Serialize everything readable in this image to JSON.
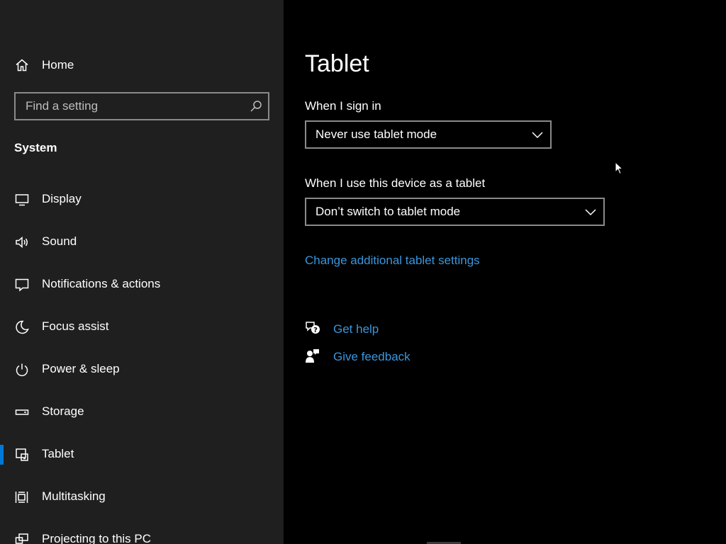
{
  "sidebar": {
    "home_label": "Home",
    "search": {
      "placeholder": "Find a setting",
      "value": ""
    },
    "section_title": "System",
    "items": [
      {
        "label": "Display",
        "icon": "monitor-icon",
        "selected": false
      },
      {
        "label": "Sound",
        "icon": "speaker-icon",
        "selected": false
      },
      {
        "label": "Notifications & actions",
        "icon": "notification-icon",
        "selected": false
      },
      {
        "label": "Focus assist",
        "icon": "moon-icon",
        "selected": false
      },
      {
        "label": "Power & sleep",
        "icon": "power-icon",
        "selected": false
      },
      {
        "label": "Storage",
        "icon": "storage-icon",
        "selected": false
      },
      {
        "label": "Tablet",
        "icon": "tablet-icon",
        "selected": true
      },
      {
        "label": "Multitasking",
        "icon": "multitasking-icon",
        "selected": false
      },
      {
        "label": "Projecting to this PC",
        "icon": "projecting-icon",
        "selected": false
      }
    ]
  },
  "main": {
    "title": "Tablet",
    "sign_in": {
      "label": "When I sign in",
      "selected": "Never use tablet mode"
    },
    "tablet_use": {
      "label": "When I use this device as a tablet",
      "selected": "Don’t switch to tablet mode"
    },
    "additional_link": "Change additional tablet settings",
    "help": {
      "get_help": "Get help",
      "give_feedback": "Give feedback"
    }
  },
  "colors": {
    "sidebar_bg": "#1f1f1f",
    "main_bg": "#000000",
    "accent": "#0078d7",
    "link": "#3a96dd",
    "border": "#8a8a8a"
  }
}
